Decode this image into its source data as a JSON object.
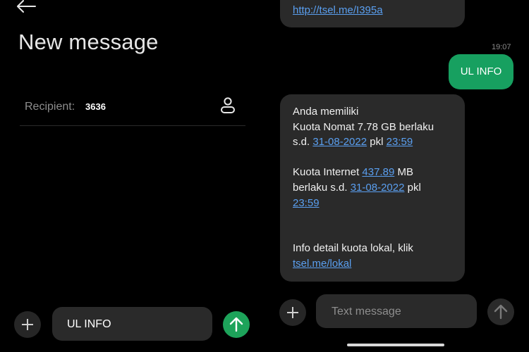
{
  "left": {
    "icons": {
      "back": "arrow-left-icon",
      "contact": "person-icon",
      "attach": "plus-icon",
      "send": "arrow-up-icon"
    },
    "title": "New message",
    "recipient_label": "Recipient:",
    "recipient_value": "3636",
    "input_value": "UL INFO",
    "send_color": "#1da35a"
  },
  "right": {
    "prev_link": "http://tsel.me/I395a",
    "time": "19:07",
    "sent_message": "UL INFO",
    "sent_color": "#17a060",
    "recv": {
      "line1": "Anda memiliki",
      "line2a": "Kuota Nomat 7.78 GB berlaku",
      "line2b_prefix": "s.d.",
      "date1": "31-08-2022",
      "pkl1": "pkl",
      "time1": "23:59",
      "line3a": "Kuota Internet",
      "mb_value": "437.89",
      "mb_unit": "MB",
      "line3b_prefix": "berlaku s.d.",
      "date2": "31-08-2022",
      "pkl2": "pkl",
      "time2": "23:59",
      "line4": "Info detail kuota lokal, klik",
      "link": "tsel.me/lokal"
    },
    "input_placeholder": "Text message",
    "link_color": "#5a9ff0"
  }
}
